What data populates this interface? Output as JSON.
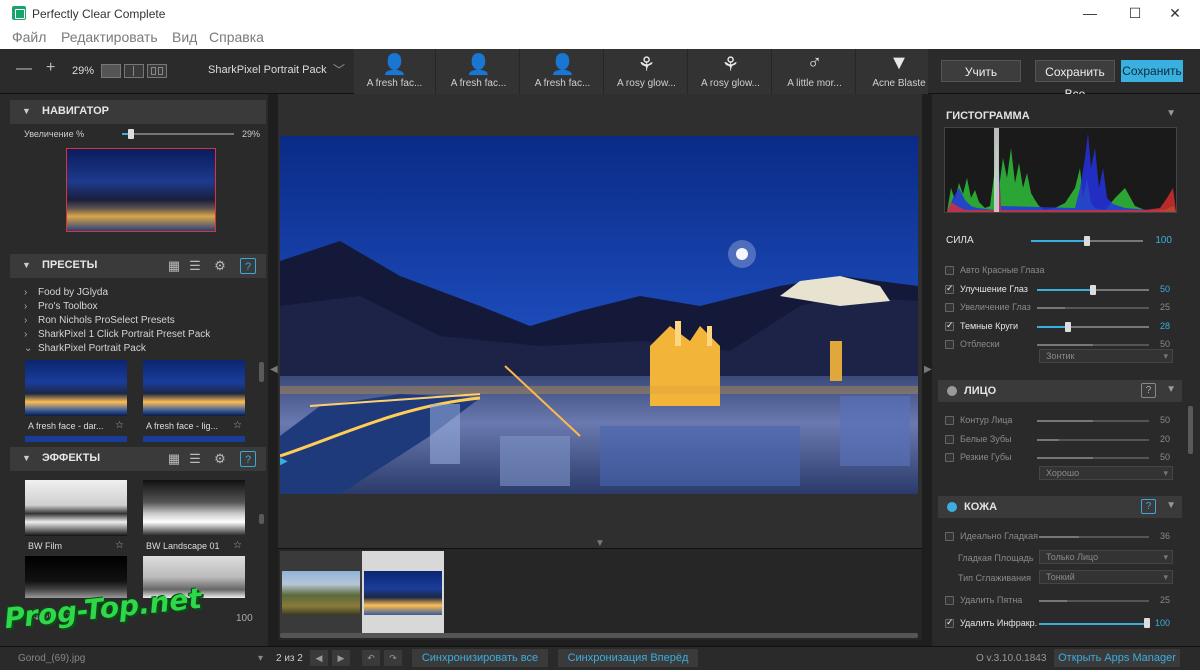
{
  "window": {
    "title": "Perfectly Clear Complete",
    "minimize": "—",
    "maximize": "☐",
    "close": "✕"
  },
  "menu": [
    "Файл",
    "Редактировать",
    "Вид",
    "Справка"
  ],
  "toolbar": {
    "zoom_out": "—",
    "zoom_in": "+",
    "zoom": "29%",
    "preset_pack": "SharkPixel Portrait Pack",
    "strip": [
      {
        "label": "A fresh fac...",
        "icon": "person-icon"
      },
      {
        "label": "A fresh fac...",
        "icon": "person-female-icon"
      },
      {
        "label": "A fresh fac...",
        "icon": "person-icon"
      },
      {
        "label": "A rosy glow...",
        "icon": "tulip-icon"
      },
      {
        "label": "A rosy glow...",
        "icon": "tulip-icon"
      },
      {
        "label": "A little mor...",
        "icon": "male-icon"
      },
      {
        "label": "Acne Blaste",
        "icon": "pizza-icon"
      }
    ],
    "apply": "Учить",
    "save_all": "Сохранить Все",
    "save": "Сохранить"
  },
  "navigator": {
    "title": "НАВИГАТОР",
    "zoom_label": "Увеличение %",
    "zoom_value": "29%",
    "zoom_level": 0.08
  },
  "presets": {
    "title": "ПРЕСЕТЫ",
    "tree": [
      "Food by JGlyda",
      "Pro's Toolbox",
      "Ron Nichols ProSelect Presets",
      "SharkPixel 1 Click Portrait Preset Pack",
      "SharkPixel Portrait Pack"
    ],
    "thumbs": [
      "A fresh face - dar...",
      "A fresh face - lig..."
    ]
  },
  "effects": {
    "title": "ЭФФЕКТЫ",
    "thumbs": [
      "BW Film",
      "BW Landscape 01"
    ],
    "footer_label": "ЭФФЕКТЫ",
    "footer_value": "100"
  },
  "histogram": {
    "title": "ГИСТОГРАММА"
  },
  "strength": {
    "label": "СИЛА",
    "value": "100",
    "level": 0.5
  },
  "eyes": {
    "rows": [
      {
        "label": "Авто Красные Глаза",
        "value": "",
        "checked": false,
        "lit": false
      },
      {
        "label": "Улучшение Глаз",
        "value": "50",
        "checked": true,
        "lit": true,
        "level": 0.5
      },
      {
        "label": "Увеличение Глаз",
        "value": "25",
        "checked": false,
        "lit": false,
        "level": 0.25
      },
      {
        "label": "Темные Круги",
        "value": "28",
        "checked": true,
        "lit": true,
        "level": 0.28
      },
      {
        "label": "Отблески",
        "value": "50",
        "checked": false,
        "lit": false,
        "level": 0.5
      }
    ],
    "dropdown": "Зонтик"
  },
  "face": {
    "title": "ЛИЦО",
    "help": "?",
    "rows": [
      {
        "label": "Контур Лица",
        "value": "50",
        "level": 0.5
      },
      {
        "label": "Белые Зубы",
        "value": "20",
        "level": 0.2
      },
      {
        "label": "Резкие Губы",
        "value": "50",
        "level": 0.5
      }
    ],
    "dropdown": "Хорошо"
  },
  "skin": {
    "title": "КОЖА",
    "help": "?",
    "smooth_label": "Идеально Гладкая",
    "smooth_value": "36",
    "smooth_level": 0.36,
    "area_label": "Гладкая Площадь",
    "area_value": "Только Лицо",
    "type_label": "Тип Сглаживания",
    "type_value": "Тонкий",
    "spots_label": "Удалить Пятна",
    "spots_value": "25",
    "spots_level": 0.25,
    "infrared_label": "Удалить Инфракр.",
    "infrared_value": "100",
    "infrared_level": 1.0
  },
  "statusbar": {
    "filename": "Gorod_(69).jpg",
    "counter": "2 из 2",
    "sync_all": "Синхронизировать все",
    "sync_forward": "Синхронизация Вперёд",
    "version": "O v.3.10.0.1843",
    "apps_manager": "Открыть Apps Manager"
  },
  "watermark": "Prog-Top.net",
  "colors": {
    "accent": "#3aaee0",
    "panel": "#2a2a2a",
    "header": "#3a3a3a"
  }
}
